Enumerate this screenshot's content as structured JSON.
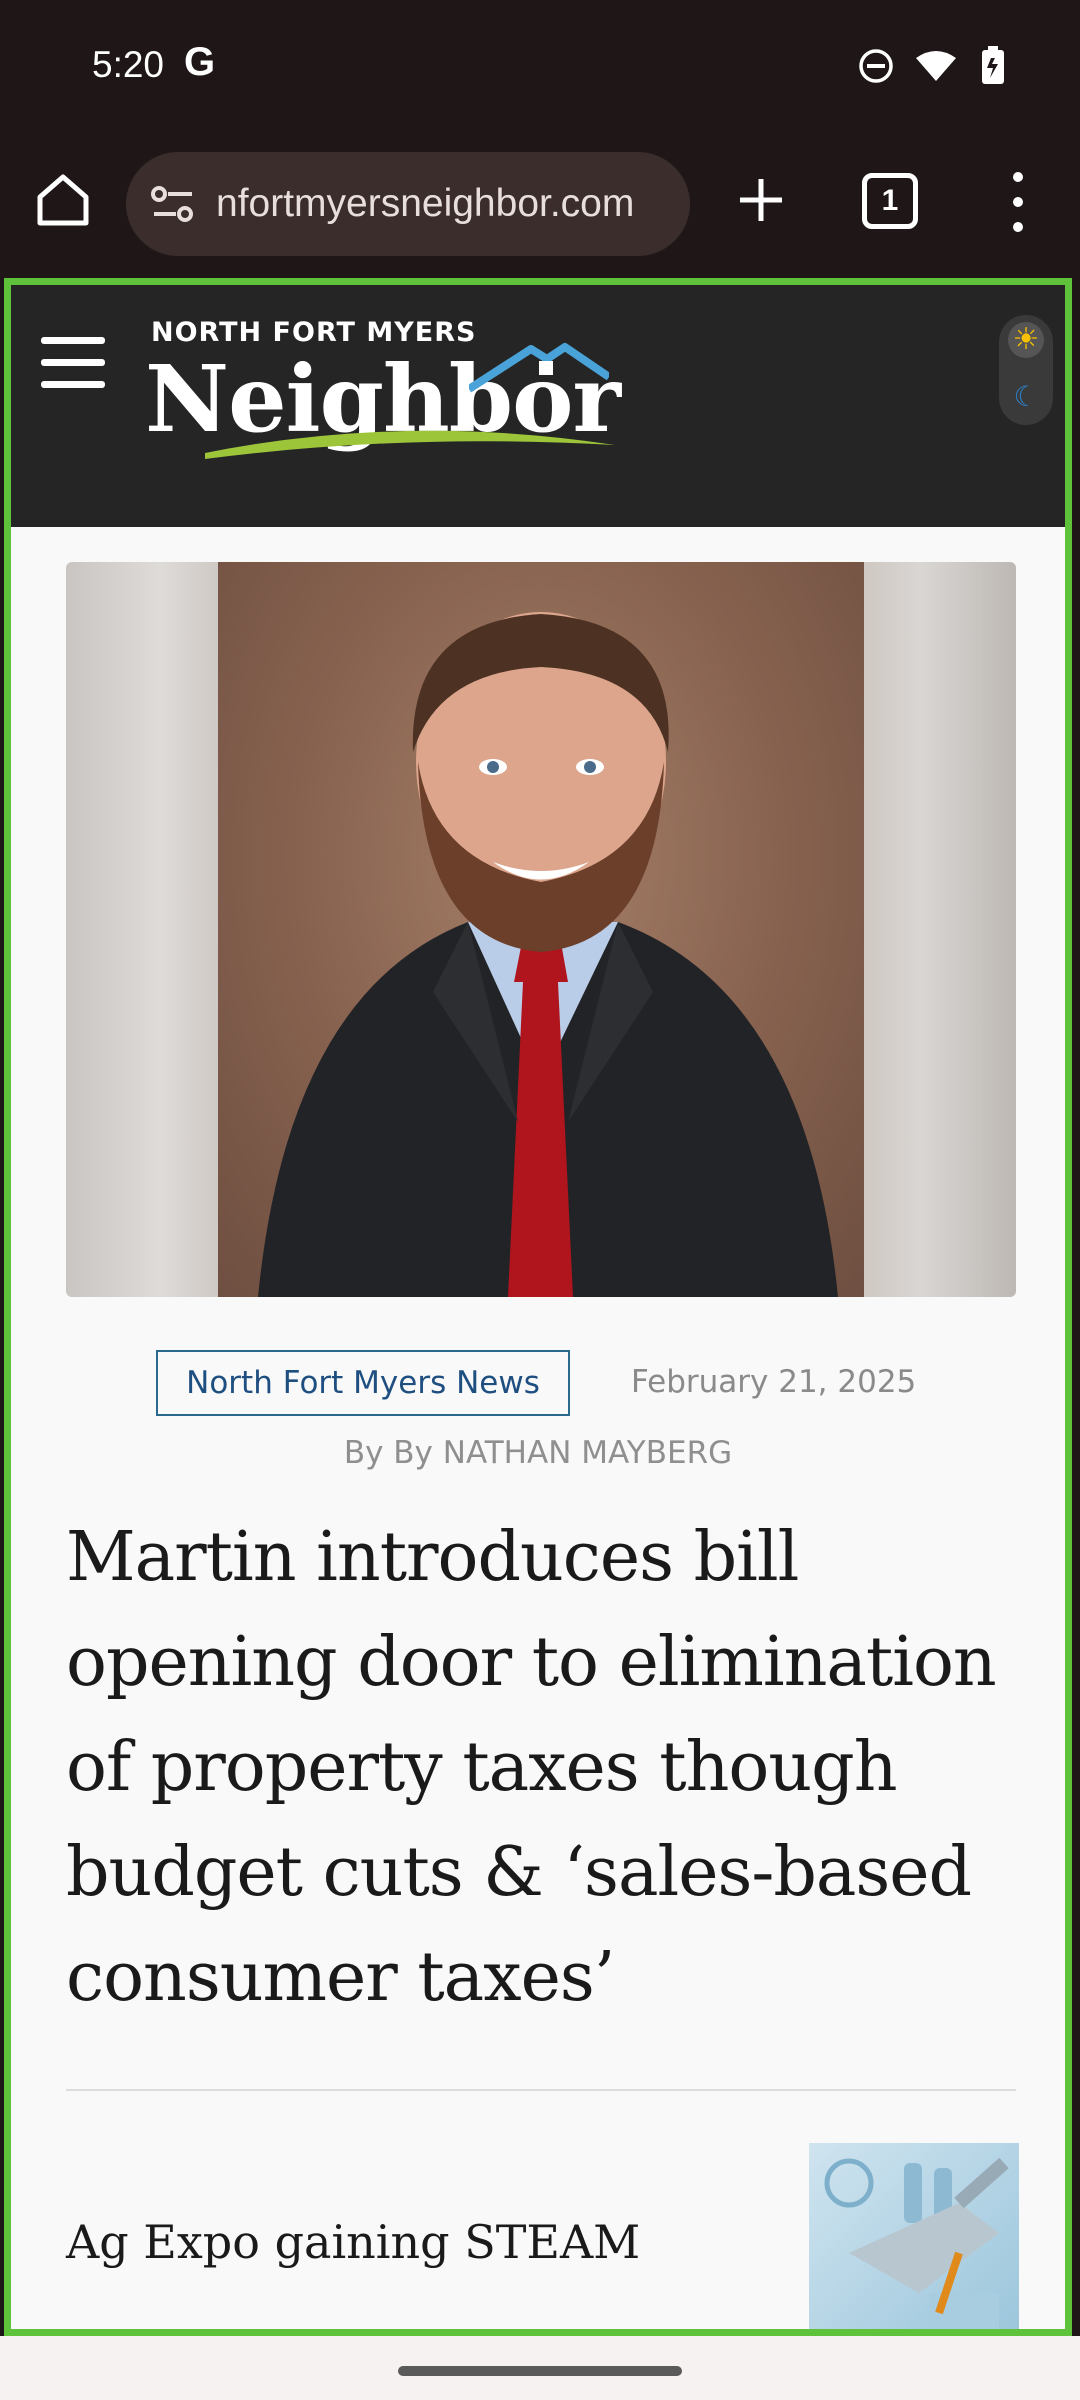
{
  "status_bar": {
    "time": "5:20",
    "g_icon": "G",
    "icons": [
      "do-not-disturb-icon",
      "wifi-icon",
      "battery-icon"
    ]
  },
  "browser": {
    "url": "nfortmyersneighbor.com",
    "tab_count": "1"
  },
  "site": {
    "logo_top": "NORTH FORT MYERS",
    "logo_main": "Neighbor",
    "theme_sun": "☀",
    "theme_moon": "☾"
  },
  "article": {
    "category": "North Fort Myers News",
    "date": "February 21, 2025",
    "byline": "By By NATHAN MAYBERG",
    "headline": "Martin introduces bill opening door to elimination of property taxes though budget cuts & ‘sales-based consumer taxes’"
  },
  "related": {
    "title": "Ag Expo gaining STEAM"
  },
  "colors": {
    "frame_border": "#5fc23b",
    "header_bg": "#252525",
    "badge_text": "#1f4f80"
  }
}
